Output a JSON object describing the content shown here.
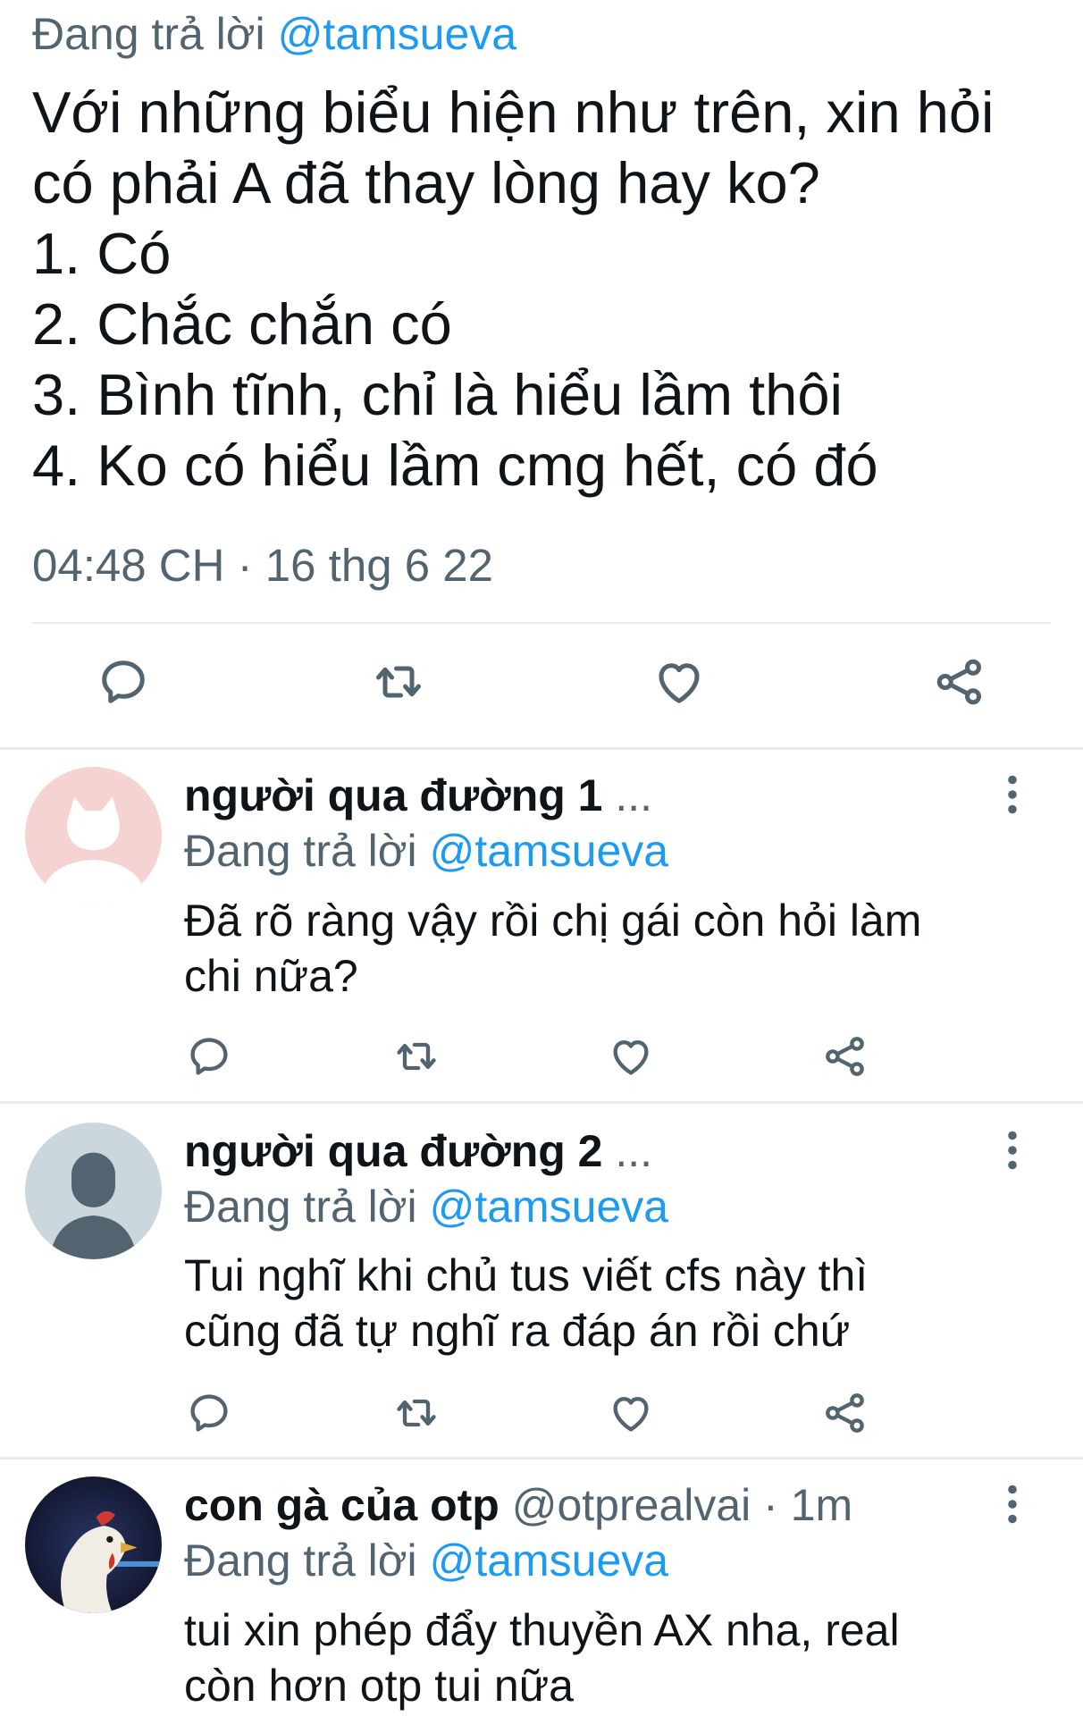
{
  "main_tweet": {
    "reply_prefix": "Đang trả lời",
    "reply_handle": "@tamsueva",
    "lines": [
      "Với những biểu hiện như trên, xin hỏi",
      "có phải A đã thay lòng hay ko?",
      "1. Có",
      "2. Chắc chắn có",
      "3. Bình tĩnh, chỉ là hiểu lầm thôi",
      "4. Ko có hiểu lầm cmg hết, có đó"
    ],
    "timestamp": "04:48 CH · 16 thg 6 22"
  },
  "actions": {
    "icons": [
      "reply-icon",
      "retweet-icon",
      "like-icon",
      "share-icon"
    ]
  },
  "replies": [
    {
      "name": "người qua đường 1",
      "name_suffix": "...",
      "handle": "",
      "time": "",
      "reply_prefix": "Đang trả lời",
      "reply_handle": "@tamsueva",
      "lines": [
        "Đã rõ ràng vậy rồi chị gái còn hỏi làm",
        "chi nữa?"
      ],
      "avatar": "cat-avatar",
      "avatar_color": "#f5d3d3"
    },
    {
      "name": "người qua đường 2",
      "name_suffix": "...",
      "handle": "",
      "time": "",
      "reply_prefix": "Đang trả lời",
      "reply_handle": "@tamsueva",
      "lines": [
        "Tui nghĩ khi chủ tus viết cfs này thì",
        "cũng đã tự nghĩ ra đáp án rồi chứ"
      ],
      "avatar": "default-person-avatar",
      "avatar_color": "#ccd6dd"
    },
    {
      "name": "con gà của otp",
      "name_suffix": "",
      "handle": "@otprealvai · 1m",
      "time": "",
      "reply_prefix": "Đang trả lời",
      "reply_handle": "@tamsueva",
      "lines": [
        "tui xin phép đẩy thuyền AX nha, real",
        "còn hơn otp tui nữa"
      ],
      "avatar": "chicken-photo-avatar",
      "avatar_color": "#1a1f3a"
    }
  ],
  "colors": {
    "link": "#1d9bf0",
    "muted": "#536471",
    "divider": "#e6ecf0",
    "text": "#0f1419"
  }
}
